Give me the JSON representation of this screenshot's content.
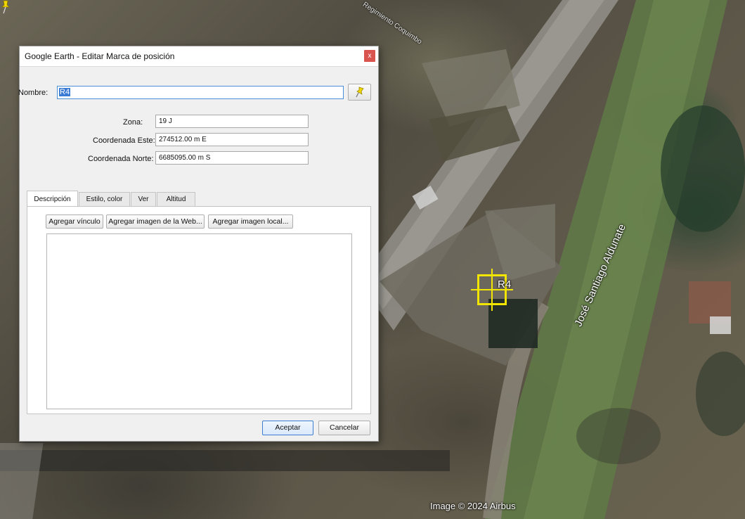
{
  "map": {
    "street_main": "José Santiago Aldunate",
    "street_top": "Regimiento Coquimbo",
    "attribution": "Image © 2024 Airbus",
    "placemark_label": "R4",
    "placemark_color": "#f2e600"
  },
  "dialog": {
    "title": "Google Earth - Editar Marca de posición",
    "close_label": "x",
    "name_label": "Nombre:",
    "name_value": "R4",
    "fields": {
      "zona_label": "Zona:",
      "zona_value": "19 J",
      "este_label": "Coordenada Este:",
      "este_value": "274512.00 m E",
      "norte_label": "Coordenada Norte:",
      "norte_value": "6685095.00 m S"
    },
    "tabs": [
      {
        "label": "Descripción",
        "active": true
      },
      {
        "label": "Estilo, color",
        "active": false
      },
      {
        "label": "Ver",
        "active": false
      },
      {
        "label": "Altitud",
        "active": false
      }
    ],
    "desc_buttons": {
      "link": "Agregar vínculo",
      "web_image": "Agregar imagen de la Web...",
      "local_image": "Agregar imagen local..."
    },
    "description_text": "",
    "ok_label": "Aceptar",
    "cancel_label": "Cancelar"
  },
  "colors": {
    "close_button": "#d9534f",
    "selection": "#3a7bd5",
    "pin_icon": "#f2d600"
  }
}
